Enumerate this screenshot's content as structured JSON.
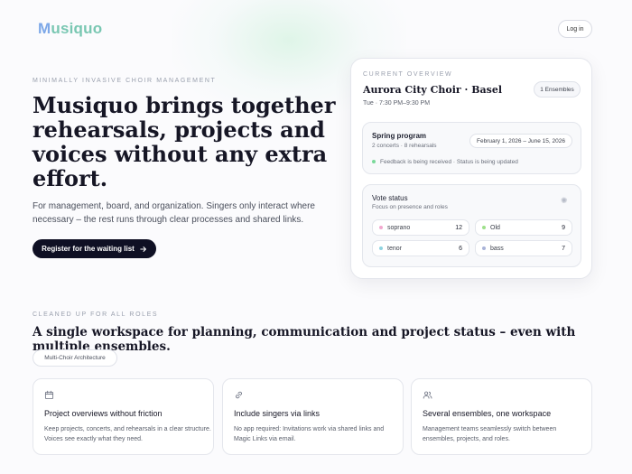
{
  "brand": {
    "logo_prefix": "M",
    "logo_rest": "usiquo"
  },
  "nav": {
    "login_label": "Log in"
  },
  "hero": {
    "eyebrow": "MINIMALLY INVASIVE CHOIR MANAGEMENT",
    "title": "Musiquo brings together rehearsals, projects and voices without any extra effort.",
    "subtitle": "For management, board, and organization. Singers only interact where necessary – the rest runs through clear processes and shared links.",
    "cta_label": "Register for the waiting list"
  },
  "overview": {
    "eyebrow": "CURRENT OVERVIEW",
    "choir_name": "Aurora City Choir · Basel",
    "schedule": "Tue · 7:30 PM–9:30 PM",
    "ensembles_badge": "1 Ensembles",
    "project": {
      "title": "Spring program",
      "meta": "2 concerts · 8 rehearsals",
      "date_range": "February 1, 2026 – June 15, 2026",
      "status": "Feedback is being received · Status is being updated"
    },
    "vote": {
      "title": "Vote status",
      "subtitle": "Focus on presence and roles",
      "voices": [
        {
          "name": "soprano",
          "count": "12",
          "color": "#f2a8cf"
        },
        {
          "name": "Old",
          "count": "9",
          "color": "#9de08a"
        },
        {
          "name": "tenor",
          "count": "6",
          "color": "#8fd3e0"
        },
        {
          "name": "bass",
          "count": "7",
          "color": "#a9b3d8"
        }
      ]
    },
    "status_dot_color": "#7ad99a"
  },
  "section": {
    "eyebrow": "CLEANED UP FOR ALL ROLES",
    "title": "A single workspace for planning, communication and project status – even with multiple ensembles.",
    "tag": "Multi-Choir Architecture",
    "features": [
      {
        "icon": "calendar-icon",
        "title": "Project overviews without friction",
        "desc": "Keep projects, concerts, and rehearsals in a clear structure. Voices see exactly what they need."
      },
      {
        "icon": "link-icon",
        "title": "Include singers via links",
        "desc": "No app required: Invitations work via shared links and Magic Links via email."
      },
      {
        "icon": "users-icon",
        "title": "Several ensembles, one workspace",
        "desc": "Management teams seamlessly switch between ensembles, projects, and roles."
      }
    ]
  }
}
